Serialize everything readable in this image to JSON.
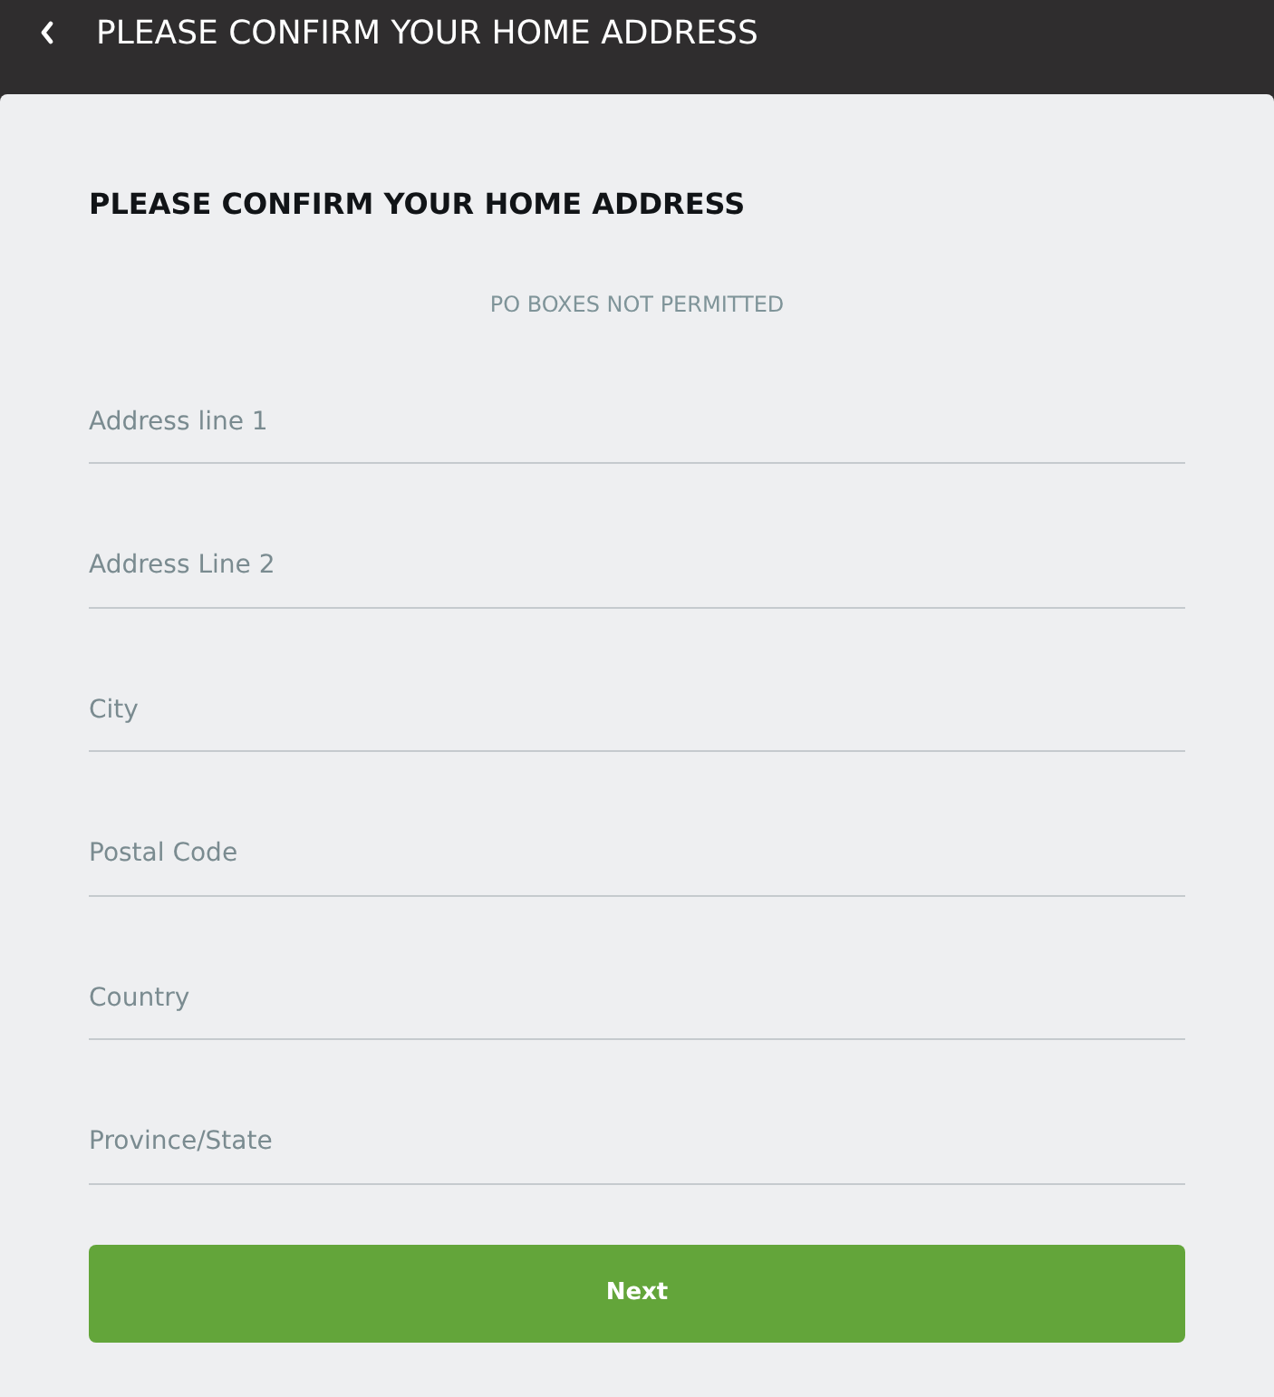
{
  "header": {
    "title": "PLEASE CONFIRM YOUR HOME ADDRESS"
  },
  "form": {
    "heading": "PLEASE CONFIRM YOUR HOME ADDRESS",
    "notice": "PO BOXES NOT PERMITTED",
    "fields": [
      {
        "placeholder": "Address line 1"
      },
      {
        "placeholder": "Address Line 2"
      },
      {
        "placeholder": "City"
      },
      {
        "placeholder": "Postal Code"
      },
      {
        "placeholder": "Country"
      },
      {
        "placeholder": "Province/State"
      }
    ],
    "button": "Next"
  }
}
